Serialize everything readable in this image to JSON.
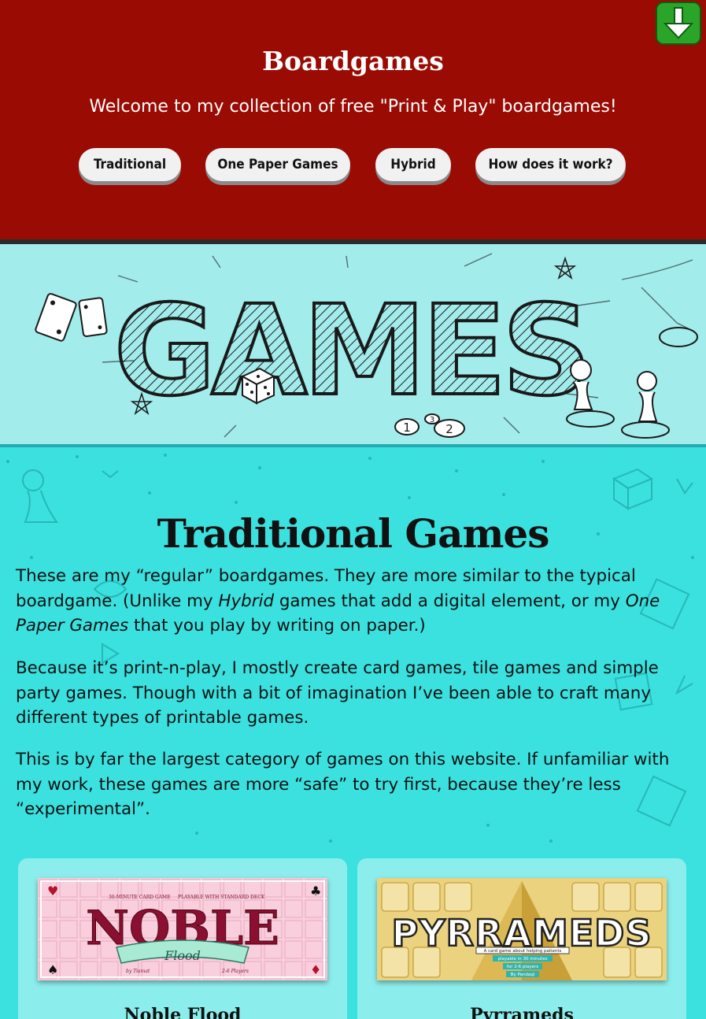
{
  "header": {
    "title": "Boardgames",
    "welcome": "Welcome to my collection of free \"Print & Play\" boardgames!",
    "nav": [
      {
        "label": "Traditional"
      },
      {
        "label": "One Paper Games"
      },
      {
        "label": "Hybrid"
      },
      {
        "label": "How does it work?"
      }
    ],
    "download_icon": "download-arrow-icon"
  },
  "banner": {
    "text": "GAMES",
    "badge_1": "1",
    "badge_2": "2",
    "badge_3": "3"
  },
  "section": {
    "title": "Traditional Games",
    "p1": {
      "a": "These are my “regular” boardgames. They are more similar to the typical boardgame. (Unlike my ",
      "em1": "Hybrid",
      "b": " games that add a digital element, or my ",
      "em2": "One Paper Games",
      "c": " that you play by writing on paper.)"
    },
    "p2": "Because it’s print-n-play, I mostly create card games, tile games and simple party games. Though with a bit of imagination I’ve been able to craft many different types of printable games.",
    "p3": "This is by far the largest category of games on this website. If unfamiliar with my work, these games are more “safe” to try first, because they’re less “experimental”."
  },
  "cards": [
    {
      "name": "Noble Flood",
      "logo": "NOBLE",
      "tag_left": "30-MINUTE CARD GAME",
      "tag_right": "PLAYABLE WITH STANDARD DECK",
      "ribbon": "Flood",
      "sub_left": "by Tiamat",
      "sub_right": "2-6 Players"
    },
    {
      "name": "Pyrrameds",
      "logo": "PYRRAMEDS",
      "tag1": "A card game about helping patients",
      "tag2": "playable in 30 minutes",
      "tag3": "for 2-6 players",
      "tag4": "By Pandaqi"
    }
  ],
  "colors": {
    "header_bg": "#990b03",
    "page_bg": "#3ae1df",
    "card_bg": "#8ceeec",
    "banner_bg": "#a3ecec"
  }
}
